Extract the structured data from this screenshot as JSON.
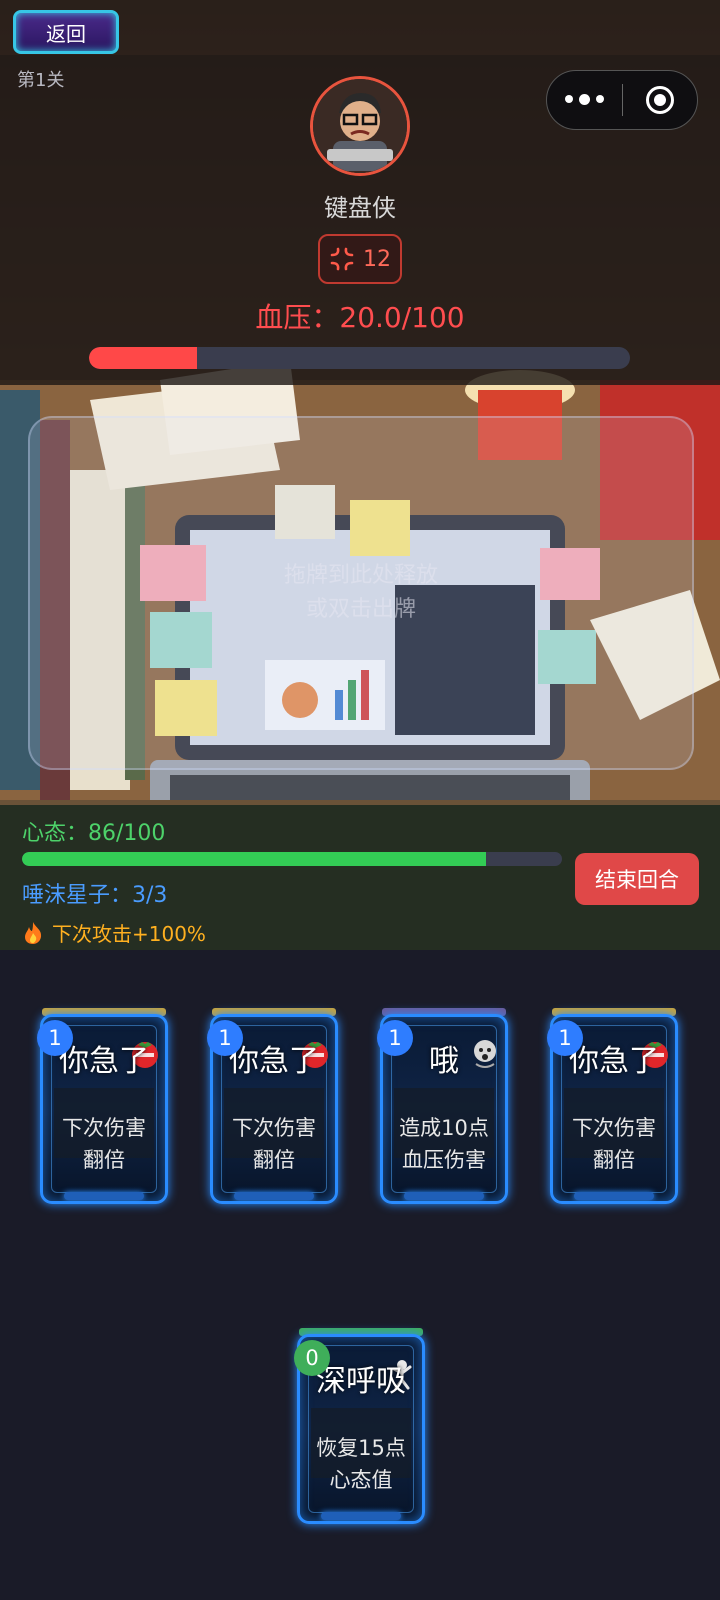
{
  "header": {
    "back_label": "返回",
    "level_label": "第1关"
  },
  "enemy": {
    "name": "键盘侠",
    "intent_value": "12",
    "intent_icon": "anger-icon",
    "blood_pressure_text": "血压：20.0/100",
    "blood_pressure_ratio": 0.2
  },
  "dropzone": {
    "line1": "拖牌到此处释放",
    "line2": "或双击出牌"
  },
  "player": {
    "mind_text": "心态：86/100",
    "mind_ratio": 0.86,
    "spit_text": "唾沫星子：3/3",
    "buff_icon": "fire-icon",
    "buff_text": "下次攻击+100%",
    "end_turn_label": "结束回合"
  },
  "hand": [
    {
      "cost": "1",
      "name": "你急了",
      "desc1": "下次伤害",
      "desc2": "翻倍",
      "top_color": "#c9a43a",
      "deco": "tomato-icon"
    },
    {
      "cost": "1",
      "name": "你急了",
      "desc1": "下次伤害",
      "desc2": "翻倍",
      "top_color": "#c9a43a",
      "deco": "tomato-icon"
    },
    {
      "cost": "1",
      "name": "哦",
      "desc1": "造成10点",
      "desc2": "血压伤害",
      "top_color": "#6a5a9a",
      "deco": "face-icon"
    },
    {
      "cost": "1",
      "name": "你急了",
      "desc1": "下次伤害",
      "desc2": "翻倍",
      "top_color": "#c9a43a",
      "deco": "tomato-icon"
    },
    {
      "cost": "0",
      "name": "深呼吸",
      "desc1": "恢复15点",
      "desc2": "心态值",
      "top_color": "#3fae5a",
      "deco": "person-icon"
    }
  ],
  "colors": {
    "blood_pressure": "#ff4848",
    "mind": "#33cc55",
    "cost_badge": "#2e7dff",
    "cost_badge_zero": "#3fae5a"
  }
}
